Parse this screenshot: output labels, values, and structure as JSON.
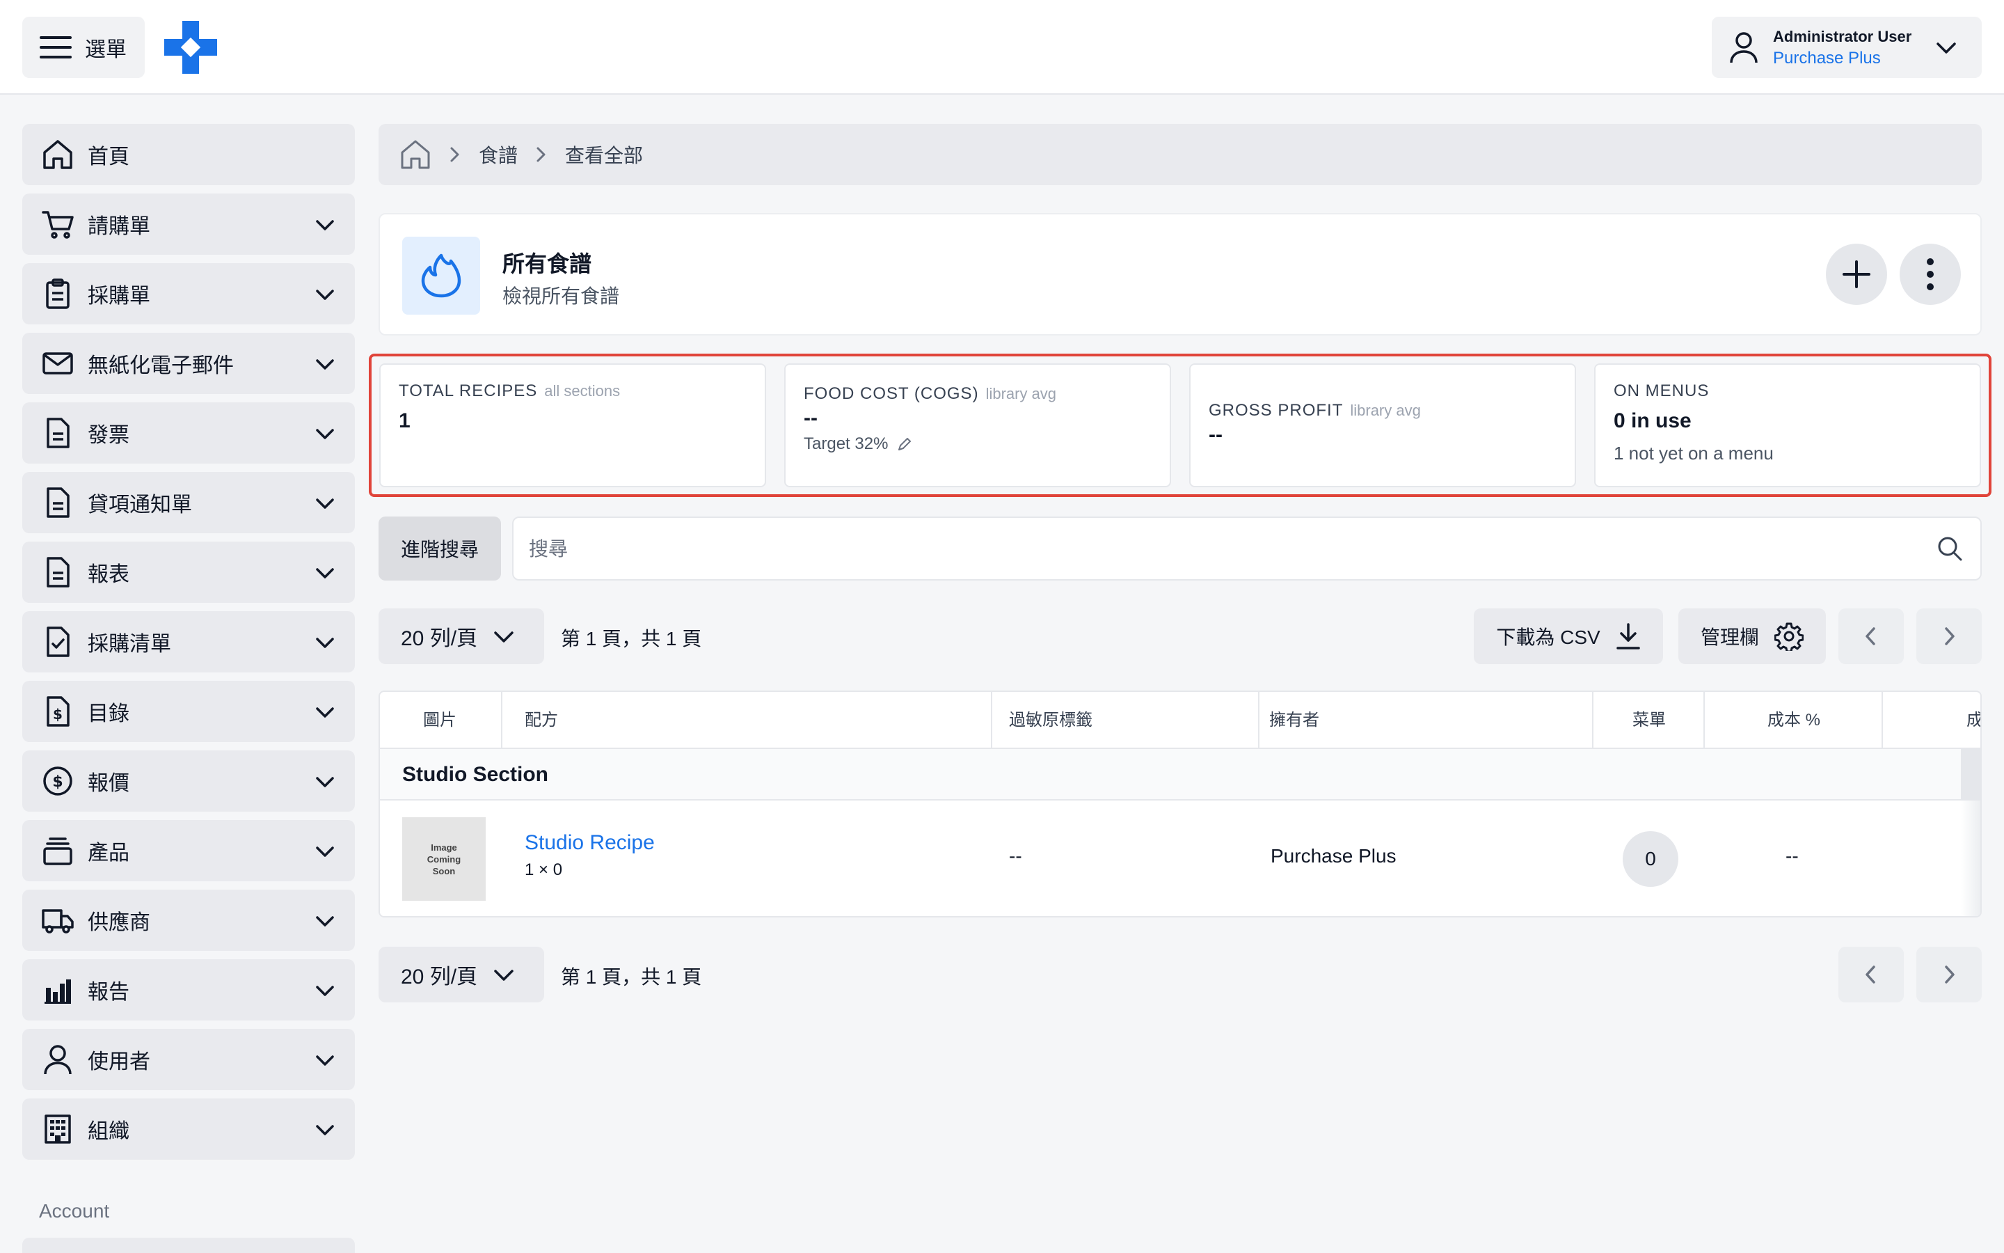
{
  "topbar": {
    "menu_label": "選單",
    "user_name": "Administrator User",
    "user_org": "Purchase Plus"
  },
  "sidebar": {
    "items": [
      {
        "label": "首頁",
        "icon": "home-icon"
      },
      {
        "label": "請購單",
        "icon": "cart-icon"
      },
      {
        "label": "採購單",
        "icon": "clipboard-icon"
      },
      {
        "label": "無紙化電子郵件",
        "icon": "mail-icon"
      },
      {
        "label": "發票",
        "icon": "document-icon"
      },
      {
        "label": "貸項通知單",
        "icon": "document-icon"
      },
      {
        "label": "報表",
        "icon": "document-icon"
      },
      {
        "label": "採購清單",
        "icon": "checklist-icon"
      },
      {
        "label": "目錄",
        "icon": "dollar-document-icon"
      },
      {
        "label": "報價",
        "icon": "dollar-circle-icon"
      },
      {
        "label": "產品",
        "icon": "stack-icon"
      },
      {
        "label": "供應商",
        "icon": "truck-icon"
      },
      {
        "label": "報告",
        "icon": "bar-chart-icon"
      },
      {
        "label": "使用者",
        "icon": "user-icon"
      },
      {
        "label": "組織",
        "icon": "building-icon"
      }
    ],
    "account_heading": "Account"
  },
  "breadcrumb": {
    "items": [
      "食譜",
      "查看全部"
    ]
  },
  "header": {
    "title": "所有食譜",
    "subtitle": "檢視所有食譜"
  },
  "stats": {
    "total_recipes": {
      "label": "TOTAL RECIPES",
      "qualifier": "all sections",
      "value": "1"
    },
    "food_cost": {
      "label": "FOOD COST (COGS)",
      "qualifier": "library avg",
      "value": "--",
      "target": "Target 32%"
    },
    "gross_profit": {
      "label": "GROSS PROFIT",
      "qualifier": "library avg",
      "value": "--"
    },
    "on_menus": {
      "label": "ON MENUS",
      "value": "0 in use",
      "note": "1 not yet on a menu"
    }
  },
  "search": {
    "advanced_label": "進階搜尋",
    "placeholder": "搜尋",
    "value": ""
  },
  "pagination": {
    "rows_per_page": "20 列/頁",
    "page_info": "第 1 頁，共 1 頁"
  },
  "toolbar": {
    "download_label": "下載為 CSV",
    "manage_columns_label": "管理欄"
  },
  "table": {
    "columns": [
      "圖片",
      "配方",
      "過敏原標籤",
      "擁有者",
      "菜單",
      "成本 %",
      "成"
    ],
    "section_title": "Studio Section",
    "rows": [
      {
        "image_text": [
          "Image",
          "Coming",
          "Soon"
        ],
        "recipe": "Studio Recipe",
        "yield": "1 × 0",
        "allergens": "--",
        "owner": "Purchase Plus",
        "menus": "0",
        "cost_pct": "--"
      }
    ]
  },
  "colors": {
    "accent": "#1a73e8",
    "highlight_outline": "#e0443a",
    "nav_background": "#e9eaee"
  }
}
